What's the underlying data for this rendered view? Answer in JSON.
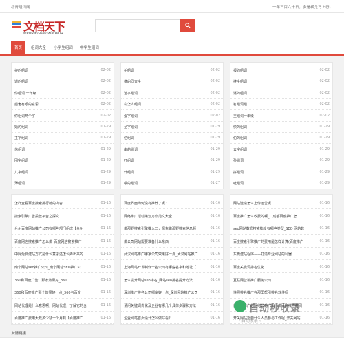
{
  "topbar": {
    "left": "初青组词网",
    "right": "一年三百六十日，多是横戈马上行。"
  },
  "logo": {
    "main": "文档天下",
    "sub": "wendangtianxia/qing"
  },
  "search": {
    "placeholder": ""
  },
  "nav": [
    "首页",
    "组词大全",
    "小学生组词",
    "中学生组词"
  ],
  "col1": [
    {
      "t": "护的组词",
      "d": "02-02"
    },
    {
      "t": "课的组词",
      "d": "02-02"
    },
    {
      "t": "你组词 一年级",
      "d": "02-02"
    },
    {
      "t": "后舍有眼的意思",
      "d": "02-02"
    },
    {
      "t": "你组词两个字",
      "d": "02-02"
    },
    {
      "t": "始的组词",
      "d": "01-29"
    },
    {
      "t": "主字组词",
      "d": "01-29"
    },
    {
      "t": "信组词",
      "d": "01-29"
    },
    {
      "t": "团字组词",
      "d": "01-29"
    },
    {
      "t": "儿字组词",
      "d": "01-29"
    },
    {
      "t": "薄组词",
      "d": "01-29"
    }
  ],
  "col2": [
    {
      "t": "护组词",
      "d": "02-02"
    },
    {
      "t": "横的同音字",
      "d": "02-02"
    },
    {
      "t": "渣字组词",
      "d": "02-02"
    },
    {
      "t": "彩怎么组词",
      "d": "02-02"
    },
    {
      "t": "蛋字组词",
      "d": "02-02"
    },
    {
      "t": "至字组词",
      "d": "01-29"
    },
    {
      "t": "信组词",
      "d": "01-29"
    },
    {
      "t": "由的组词",
      "d": "01-29"
    },
    {
      "t": "叮组词",
      "d": "01-29"
    },
    {
      "t": "什组词",
      "d": "01-29"
    },
    {
      "t": "喂的组词",
      "d": "01-27"
    }
  ],
  "col3": [
    {
      "t": "报的组词",
      "d": "02-02"
    },
    {
      "t": "挫字组词",
      "d": "02-02"
    },
    {
      "t": "逐的组词",
      "d": "02-02"
    },
    {
      "t": "钉组词组",
      "d": "02-02"
    },
    {
      "t": "王组词一年级",
      "d": "02-02"
    },
    {
      "t": "快的组词",
      "d": "01-29"
    },
    {
      "t": "伯的组词",
      "d": "01-29"
    },
    {
      "t": "去字组词",
      "d": "01-29"
    },
    {
      "t": "孙组词",
      "d": "01-29"
    },
    {
      "t": "拼组词",
      "d": "01-29"
    },
    {
      "t": "吐组词",
      "d": "01-29"
    }
  ],
  "col4": [
    {
      "t": "怎样查看百度搜索排行榜的内容",
      "d": "01-16"
    },
    {
      "t": "搜索引擎广告投放平台之探究",
      "d": "01-16"
    },
    {
      "t": "台州百度网站推广公司有哪些部门组成【台州",
      "d": "01-16"
    },
    {
      "t": "百度网店搜索推广怎么做_百度网店搜索推广",
      "d": "01-16"
    },
    {
      "t": "中网免费建站方式是什么意思还怎么弄出来的",
      "d": "01-16"
    },
    {
      "t": "南宁网站seo推广公司_南宁网站SEO推广公",
      "d": "01-16"
    },
    {
      "t": "360和百度广告，那家效果好_360",
      "d": "01-16"
    },
    {
      "t": "360和百度推广那个效果好一点_360与百度",
      "d": "01-16"
    },
    {
      "t": "网站代理是什么意思啊，网站代理，了解它的含",
      "d": "01-16"
    },
    {
      "t": "百度推广费用大概多少钱一个月啊【百度推广",
      "d": "01-16"
    }
  ],
  "col5": [
    {
      "t": "百度界面为何没有推荐了呢？",
      "d": "01-16"
    },
    {
      "t": "网络推广活动策划方案范文大全",
      "d": "01-16"
    },
    {
      "t": "做那野搜索引擎推入口，探索做那野搜索信息领",
      "d": "01-16"
    },
    {
      "t": "做公司网站需要准备什么东西",
      "d": "01-16"
    },
    {
      "t": "武汉网站推广哪家公司效果好一点_武汉网站推广",
      "d": "01-16"
    },
    {
      "t": "上海网站开发制作十名公司有哪些名字和地址【",
      "d": "01-16"
    },
    {
      "t": "怎么提升网站seo排名_网站seo排名提升方法",
      "d": "01-16"
    },
    {
      "t": "深圳推广排名公司哪家好一点_深圳网站推广公司",
      "d": "01-16"
    },
    {
      "t": "请问关键词优化及企业有哪几个具体步骤和方法",
      "d": "01-16"
    },
    {
      "t": "企业网站首页设计怎么做好看？",
      "d": "01-16"
    }
  ],
  "col6": [
    {
      "t": "网站建设怎么上传运营呢",
      "d": "01-16"
    },
    {
      "t": "百度推广怎么收费的啊_，成都百度推广怎",
      "d": "01-16"
    },
    {
      "t": "seo网站数据搜索指令有哪些类型_SEO 网站数",
      "d": "01-16"
    },
    {
      "t": "百度搜索引擎推广的费用是怎样计算(百度推广",
      "d": "01-16"
    },
    {
      "t": "东莞建站程序——打造专业网站的利器",
      "d": "01-16"
    },
    {
      "t": "百度关键词排名优化",
      "d": "01-16"
    },
    {
      "t": "互联网营销推广服务公司",
      "d": "01-16"
    },
    {
      "t": "快照排名推广在那里帮引排名软件吗",
      "d": "01-16"
    },
    {
      "t": "做百度推广的网络公司广州【做百度推广的网",
      "d": "01-16"
    },
    {
      "t": "开关网站需要什么人员参与工作呢_开关网站",
      "d": "01-16"
    }
  ],
  "links_title": "友情链接",
  "watermark": {
    "main": "自动秒收录",
    "sub": "→ 自动收录 ←"
  }
}
